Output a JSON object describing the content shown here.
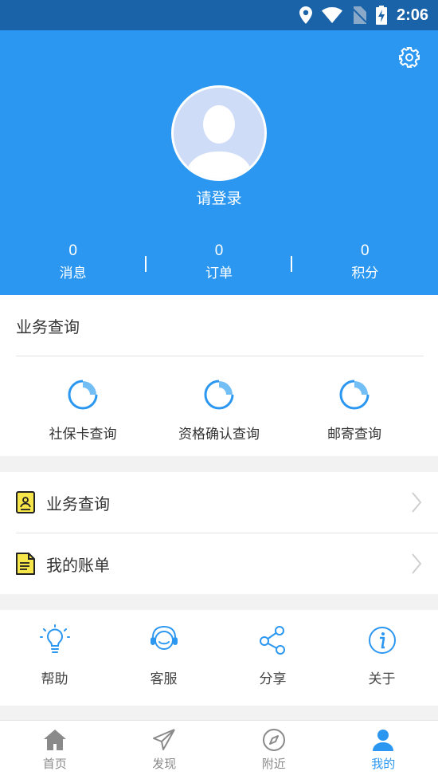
{
  "status_bar": {
    "time": "2:06"
  },
  "profile": {
    "login_text": "请登录"
  },
  "stats": [
    {
      "value": "0",
      "label": "消息"
    },
    {
      "value": "0",
      "label": "订单"
    },
    {
      "value": "0",
      "label": "积分"
    }
  ],
  "business": {
    "title": "业务查询",
    "items": [
      {
        "label": "社保卡查询"
      },
      {
        "label": "资格确认查询"
      },
      {
        "label": "邮寄查询"
      }
    ]
  },
  "menu": [
    {
      "label": "业务查询",
      "icon": "id-badge-icon"
    },
    {
      "label": "我的账单",
      "icon": "document-icon"
    }
  ],
  "tools": [
    {
      "label": "帮助",
      "icon": "lightbulb-icon"
    },
    {
      "label": "客服",
      "icon": "headset-icon"
    },
    {
      "label": "分享",
      "icon": "share-icon"
    },
    {
      "label": "关于",
      "icon": "info-icon"
    }
  ],
  "tabbar": [
    {
      "label": "首页",
      "icon": "home-icon"
    },
    {
      "label": "发现",
      "icon": "paper-plane-icon"
    },
    {
      "label": "附近",
      "icon": "compass-icon"
    },
    {
      "label": "我的",
      "icon": "person-icon",
      "active": true
    }
  ],
  "colors": {
    "primary": "#2b97f0",
    "status_bar": "#1a63a8",
    "doc_yellow": "#f7e64a"
  }
}
